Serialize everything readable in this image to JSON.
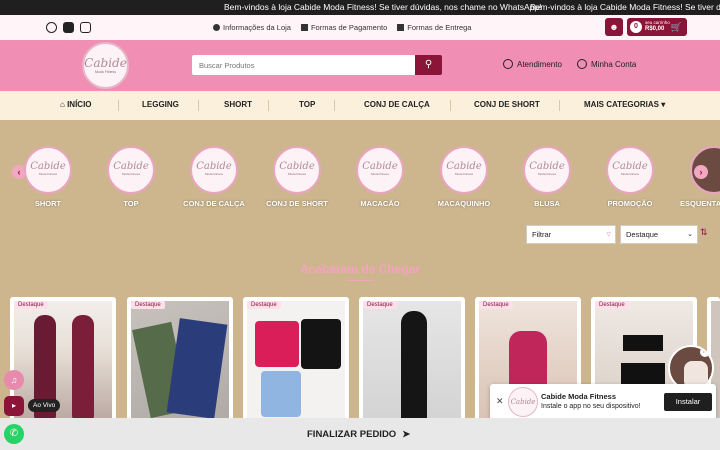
{
  "marquee": {
    "message1": "Bem-vindos à loja Cabide Moda Fitness! Se tiver dúvidas, nos chame no WhatsApp!",
    "message2": "Bem-vindos à loja Cabide Moda Fitness! Se tiver dúvidas"
  },
  "topbar": {
    "links": [
      "Informações da Loja",
      "Formas de Pagamento",
      "Formas de Entrega"
    ],
    "cart_count": "0",
    "cart_label": "seu carrinho",
    "cart_value": "R$0,00"
  },
  "header": {
    "logo_text": "Cabide",
    "logo_sub": "Moda Fitness",
    "search_placeholder": "Buscar Produtos",
    "atendimento": "Atendimento",
    "minha_conta": "Minha Conta"
  },
  "nav": {
    "items": [
      "INÍCIO",
      "LEGGING",
      "SHORT",
      "TOP",
      "CONJ DE CALÇA",
      "CONJ DE SHORT",
      "MAIS CATEGORIAS"
    ]
  },
  "categories": [
    "SHORT",
    "TOP",
    "CONJ DE CALÇA",
    "CONJ DE SHORT",
    "MACACÃO",
    "MACAQUINHO",
    "BLUSA",
    "PROMOÇÃO",
    "ESQUENTA"
  ],
  "filters": {
    "filter_label": "Filtrar",
    "sort_label": "Destaque"
  },
  "section": {
    "title": "Acabaram de Chegar"
  },
  "products": [
    {
      "badge": "Destaque"
    },
    {
      "badge": "Destaque"
    },
    {
      "badge": "Destaque"
    },
    {
      "badge": "Destaque"
    },
    {
      "badge": "Destaque"
    },
    {
      "badge": "Destaque"
    }
  ],
  "floating": {
    "live_label": "Ao Vivo",
    "finalize": "FINALIZAR PEDIDO"
  },
  "install_banner": {
    "name": "Cabide Moda Fitness",
    "subtitle": "Instale o app no seu dispositivo!",
    "button": "Instalar"
  },
  "colors": {
    "brand": "#8b1538",
    "header_pink": "#f08fb3",
    "background": "#cdb68e"
  }
}
